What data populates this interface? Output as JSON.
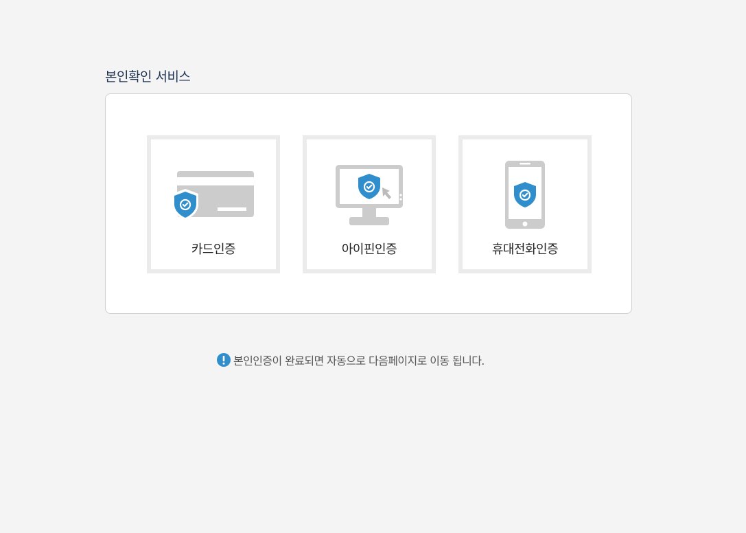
{
  "page": {
    "title": "본인확인 서비스"
  },
  "options": [
    {
      "id": "card",
      "label": "카드인증",
      "icon": "credit-card-shield-icon"
    },
    {
      "id": "ipin",
      "label": "아이핀인증",
      "icon": "monitor-shield-icon"
    },
    {
      "id": "phone",
      "label": "휴대전화인증",
      "icon": "mobile-phone-shield-icon"
    }
  ],
  "notice": {
    "icon": "exclamation-icon",
    "text": "본인인증이 완료되면 자동으로 다음페이지로 이동 됩니다."
  },
  "colors": {
    "accent": "#2f8ecb",
    "title": "#1f3553",
    "icon_gray": "#cccccc",
    "tile_border": "#ebebeb"
  }
}
